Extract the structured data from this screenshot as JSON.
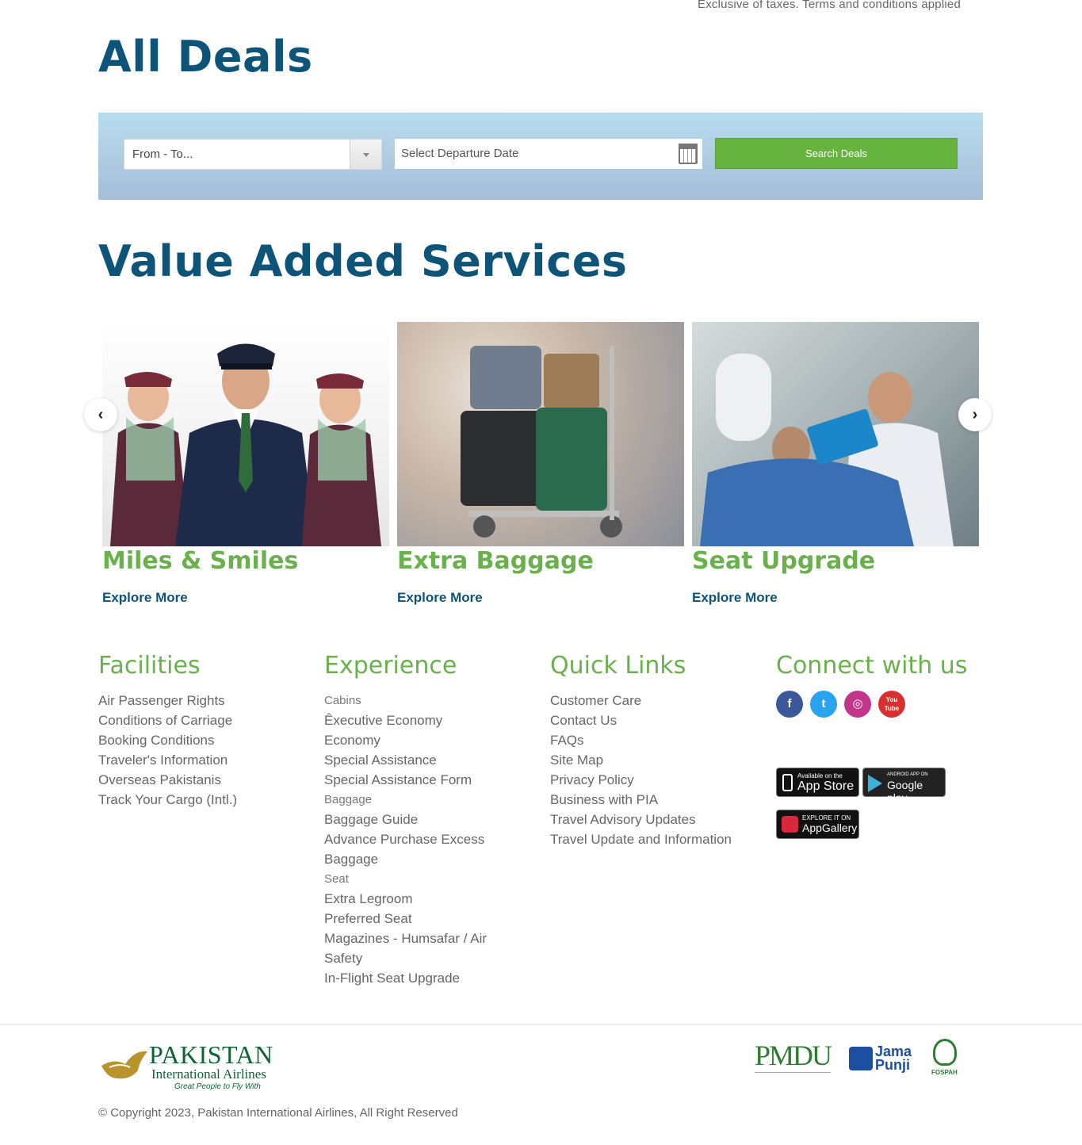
{
  "top_note": "Exclusive of taxes. Terms and conditions applied",
  "deals": {
    "title": "All Deals",
    "route_placeholder": "From - To...",
    "date_placeholder": "Select Departure Date",
    "search_label": "Search Deals"
  },
  "services": {
    "title": "Value Added Services",
    "prev": "‹",
    "next": "›",
    "cards": [
      {
        "title": "Miles & Smiles",
        "link": "Explore More"
      },
      {
        "title": "Extra Baggage",
        "link": "Explore More"
      },
      {
        "title": "Seat Upgrade",
        "link": "Explore More"
      }
    ]
  },
  "footer": {
    "facilities": {
      "heading": "Facilities",
      "links": [
        "Air Passenger Rights",
        "Conditions of Carriage",
        "Booking Conditions",
        "Traveler's Information",
        "Overseas Pakistanis",
        "Track Your Cargo (Intl.)"
      ]
    },
    "experience": {
      "heading": "Experience",
      "cabins_label": "Cabins",
      "cabins": [
        "Êxecutive Economy",
        "Economy",
        "Special Assistance",
        "Special Assistance Form"
      ],
      "baggage_label": "Baggage",
      "baggage": [
        "Baggage Guide",
        "Advance Purchase Excess Baggage"
      ],
      "seat_label": "Seat",
      "seat": [
        "Extra Legroom",
        "Preferred Seat",
        "Magazines - Humsafar / Air Safety",
        "In-Flight Seat Upgrade"
      ]
    },
    "quick_links": {
      "heading": "Quick Links",
      "links": [
        "Customer Care",
        "Contact Us",
        "FAQs",
        "Site Map",
        "Privacy Policy",
        "Business with PIA",
        "Travel Advisory Updates",
        "Travel Update and Information"
      ]
    },
    "connect": {
      "heading": "Connect with us",
      "social": [
        {
          "name": "facebook-icon",
          "glyph": "f",
          "color": "#3b5998"
        },
        {
          "name": "twitter-icon",
          "glyph": "t",
          "color": "#2aa3ef"
        },
        {
          "name": "instagram-icon",
          "glyph": "◎",
          "color": "#c1358a"
        },
        {
          "name": "youtube-icon",
          "glyph": "You Tube",
          "color": "#d8302e"
        }
      ],
      "app_store_small": "Available on the",
      "app_store_big": "App Store",
      "google_small": "ANDROID APP ON",
      "google_big": "Google play",
      "huawei_small": "EXPLORE IT ON",
      "huawei_big": "AppGallery"
    },
    "logo_main": "PAKISTAN",
    "logo_sub": "International Airlines",
    "logo_tag": "Great People to Fly With",
    "partners": [
      "PMDU",
      "Jama Punji",
      "FOSPAH"
    ],
    "copyright": "© Copyright 2023, Pakistan International Airlines, All Right Reserved"
  }
}
